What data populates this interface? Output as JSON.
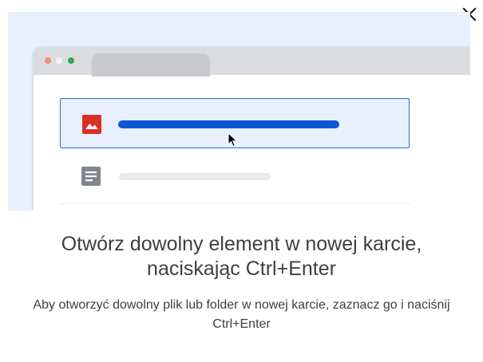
{
  "dialog": {
    "close_icon": "close-icon",
    "title": "Otwórz dowolny element w nowej karcie, naciskając Ctrl+Enter",
    "description": "Aby otworzyć dowolny plik lub folder w nowej karcie, zaznacz go i naciśnij Ctrl+Enter"
  },
  "illustration": {
    "selected_item_icon": "image-file-icon",
    "doc_item_icon": "document-file-icon",
    "pointer_icon": "mouse-pointer-icon",
    "colors": {
      "background": "#e8f0fe",
      "selection_border": "#1a73e8",
      "selection_bar": "#0b57d0",
      "image_icon": "#d93025",
      "doc_icon": "#80868b"
    }
  }
}
